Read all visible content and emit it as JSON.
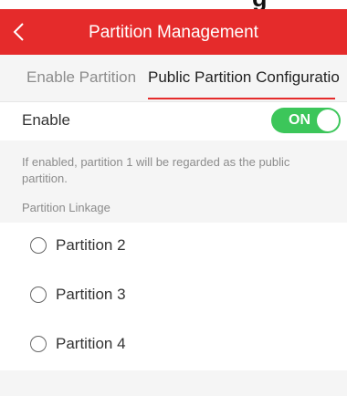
{
  "clipped_title_fragment": "g",
  "header": {
    "title": "Partition Management",
    "background_color": "#e52b2b",
    "back_icon": "chevron-left-icon"
  },
  "tabs": [
    {
      "label": "Enable Partition",
      "active": false
    },
    {
      "label": "Public Partition Configuration",
      "active": true
    }
  ],
  "enable": {
    "label": "Enable",
    "toggle_text": "ON",
    "toggle_state": true,
    "toggle_color": "#3cc65a"
  },
  "info": {
    "description": "If enabled, partition 1 will be regarded as the public partition.",
    "linkage_label": "Partition Linkage"
  },
  "partitions": [
    {
      "label": "Partition 2",
      "selected": false
    },
    {
      "label": "Partition 3",
      "selected": false
    },
    {
      "label": "Partition 4",
      "selected": false
    }
  ]
}
